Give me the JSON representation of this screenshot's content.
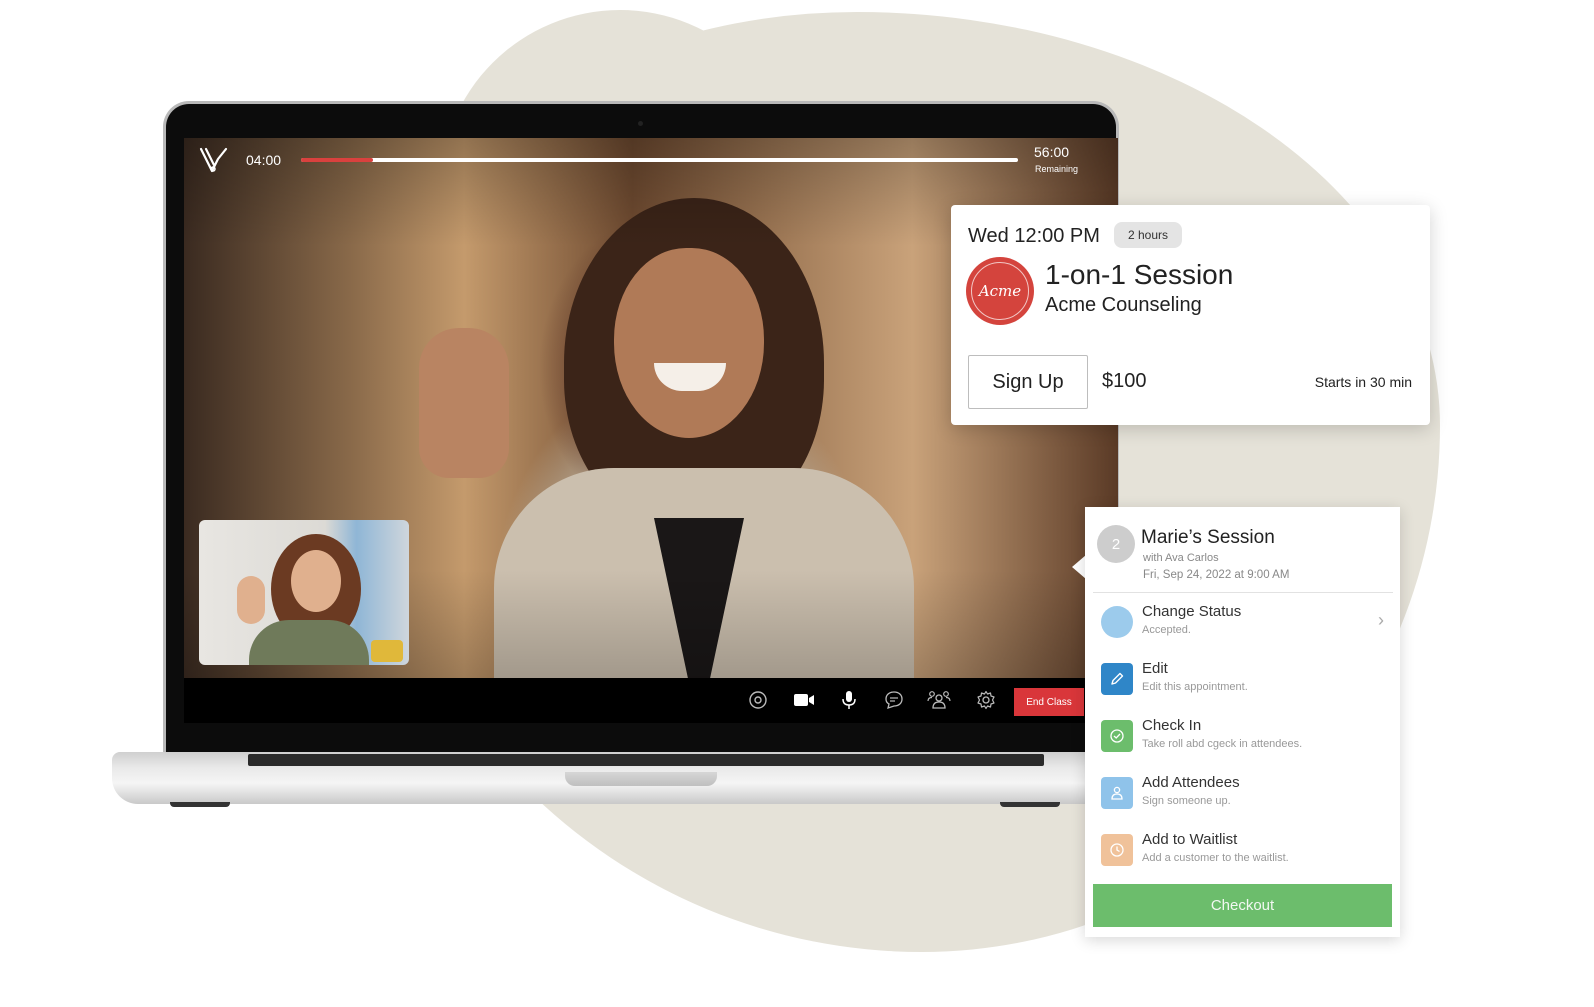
{
  "video_player": {
    "brand_icon": "v-logo-icon",
    "elapsed": "04:00",
    "remaining_time": "56:00",
    "remaining_label": "Remaining",
    "progress_percent": 10,
    "colors": {
      "progress_fill": "#d9413e",
      "progress_track": "#ffffff",
      "end_class": "#d9363a"
    },
    "controls": [
      {
        "name": "record",
        "icon": "record-icon"
      },
      {
        "name": "camera",
        "icon": "video-camera-icon"
      },
      {
        "name": "microphone",
        "icon": "microphone-icon"
      },
      {
        "name": "chat",
        "icon": "chat-bubble-icon"
      },
      {
        "name": "participants",
        "icon": "participants-icon"
      },
      {
        "name": "settings",
        "icon": "gear-icon"
      }
    ],
    "end_class_label": "End Class"
  },
  "session_card": {
    "time": "Wed 12:00 PM",
    "duration_badge": "2 hours",
    "logo_text": "Acme",
    "title": "1-on-1 Session",
    "organization": "Acme Counseling",
    "signup_label": "Sign Up",
    "price": "$100",
    "starts_in": "Starts in 30 min",
    "colors": {
      "logo_bg": "#d4443d"
    }
  },
  "appointment_panel": {
    "number": "2",
    "title": "Marie’s Session",
    "with": "with Ava Carlos",
    "date": "Fri, Sep 24, 2022 at 9:00 AM",
    "actions": [
      {
        "label": "Change Status",
        "sub": "Accepted.",
        "icon": "status-dot-icon",
        "color": "#9ccbec"
      },
      {
        "label": "Edit",
        "sub": "Edit this appointment.",
        "icon": "pencil-icon",
        "color": "#2f86c8"
      },
      {
        "label": "Check In",
        "sub": "Take roll abd cgeck in attendees.",
        "icon": "check-circle-icon",
        "color": "#6cbd6c"
      },
      {
        "label": "Add Attendees",
        "sub": "Sign someone up.",
        "icon": "person-icon",
        "color": "#8fc3ea"
      },
      {
        "label": "Add to Waitlist",
        "sub": "Add a customer to the waitlist.",
        "icon": "clock-icon",
        "color": "#f0c29a"
      }
    ],
    "checkout_label": "Checkout",
    "colors": {
      "checkout": "#6cbd6c"
    }
  }
}
